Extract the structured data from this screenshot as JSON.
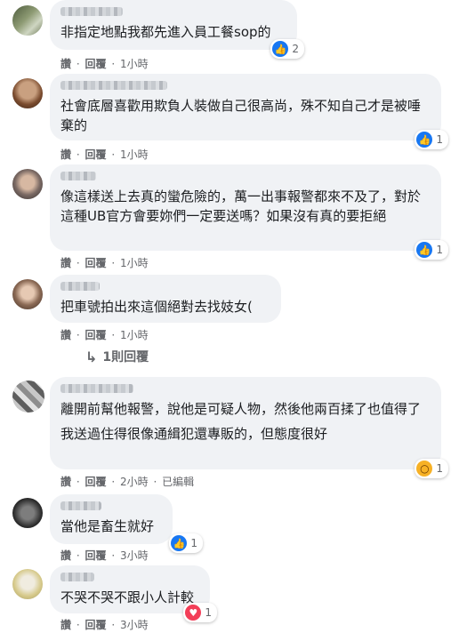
{
  "comments": [
    {
      "text": "非指定地點我都先進入員工餐sop的",
      "reaction": {
        "type": "like",
        "count": "2"
      },
      "meta": {
        "like": "讚",
        "reply": "回覆",
        "time": "1小時"
      }
    },
    {
      "text": "社會底層喜歡用欺負人裝做自己很高尚，殊不知自己才是被唾棄的",
      "reaction": {
        "type": "like",
        "count": "1"
      },
      "meta": {
        "like": "讚",
        "reply": "回覆",
        "time": "1小時"
      }
    },
    {
      "text": "像這樣送上去真的蠻危險的，萬一出事報警都來不及了，對於這種UB官方會要妳們一定要送嗎？如果沒有真的要拒絕",
      "reaction": {
        "type": "like",
        "count": "1"
      },
      "meta": {
        "like": "讚",
        "reply": "回覆",
        "time": "1小時"
      }
    },
    {
      "text": "把車號拍出來這個絕對去找妓女(",
      "reaction": null,
      "meta": {
        "like": "讚",
        "reply": "回覆",
        "time": "1小時"
      },
      "replies": "1則回覆"
    },
    {
      "text": "離開前幫他報警，說他是可疑人物，然後他兩百揉了也值得了",
      "text2": "我送過住得很像通緝犯還專販的，但態度很好",
      "reaction": {
        "type": "wow",
        "count": "1"
      },
      "meta": {
        "like": "讚",
        "reply": "回覆",
        "time": "2小時",
        "edited": "已編輯"
      }
    },
    {
      "text": "當他是畜生就好",
      "reaction": {
        "type": "like",
        "count": "1"
      },
      "meta": {
        "like": "讚",
        "reply": "回覆",
        "time": "3小時"
      }
    },
    {
      "text": "不哭不哭不跟小人計較",
      "reaction": {
        "type": "love",
        "count": "1"
      },
      "meta": {
        "like": "讚",
        "reply": "回覆",
        "time": "3小時"
      }
    }
  ],
  "separator": "·",
  "colors": {
    "bubble": "#f0f2f5",
    "like": "#1877f2",
    "wow": "#f7b125",
    "love": "#f33e58"
  },
  "icons": {
    "like": "thumbs-up-icon",
    "wow": "wow-face-icon",
    "love": "heart-icon",
    "reply_arrow": "reply-arrow-icon"
  }
}
